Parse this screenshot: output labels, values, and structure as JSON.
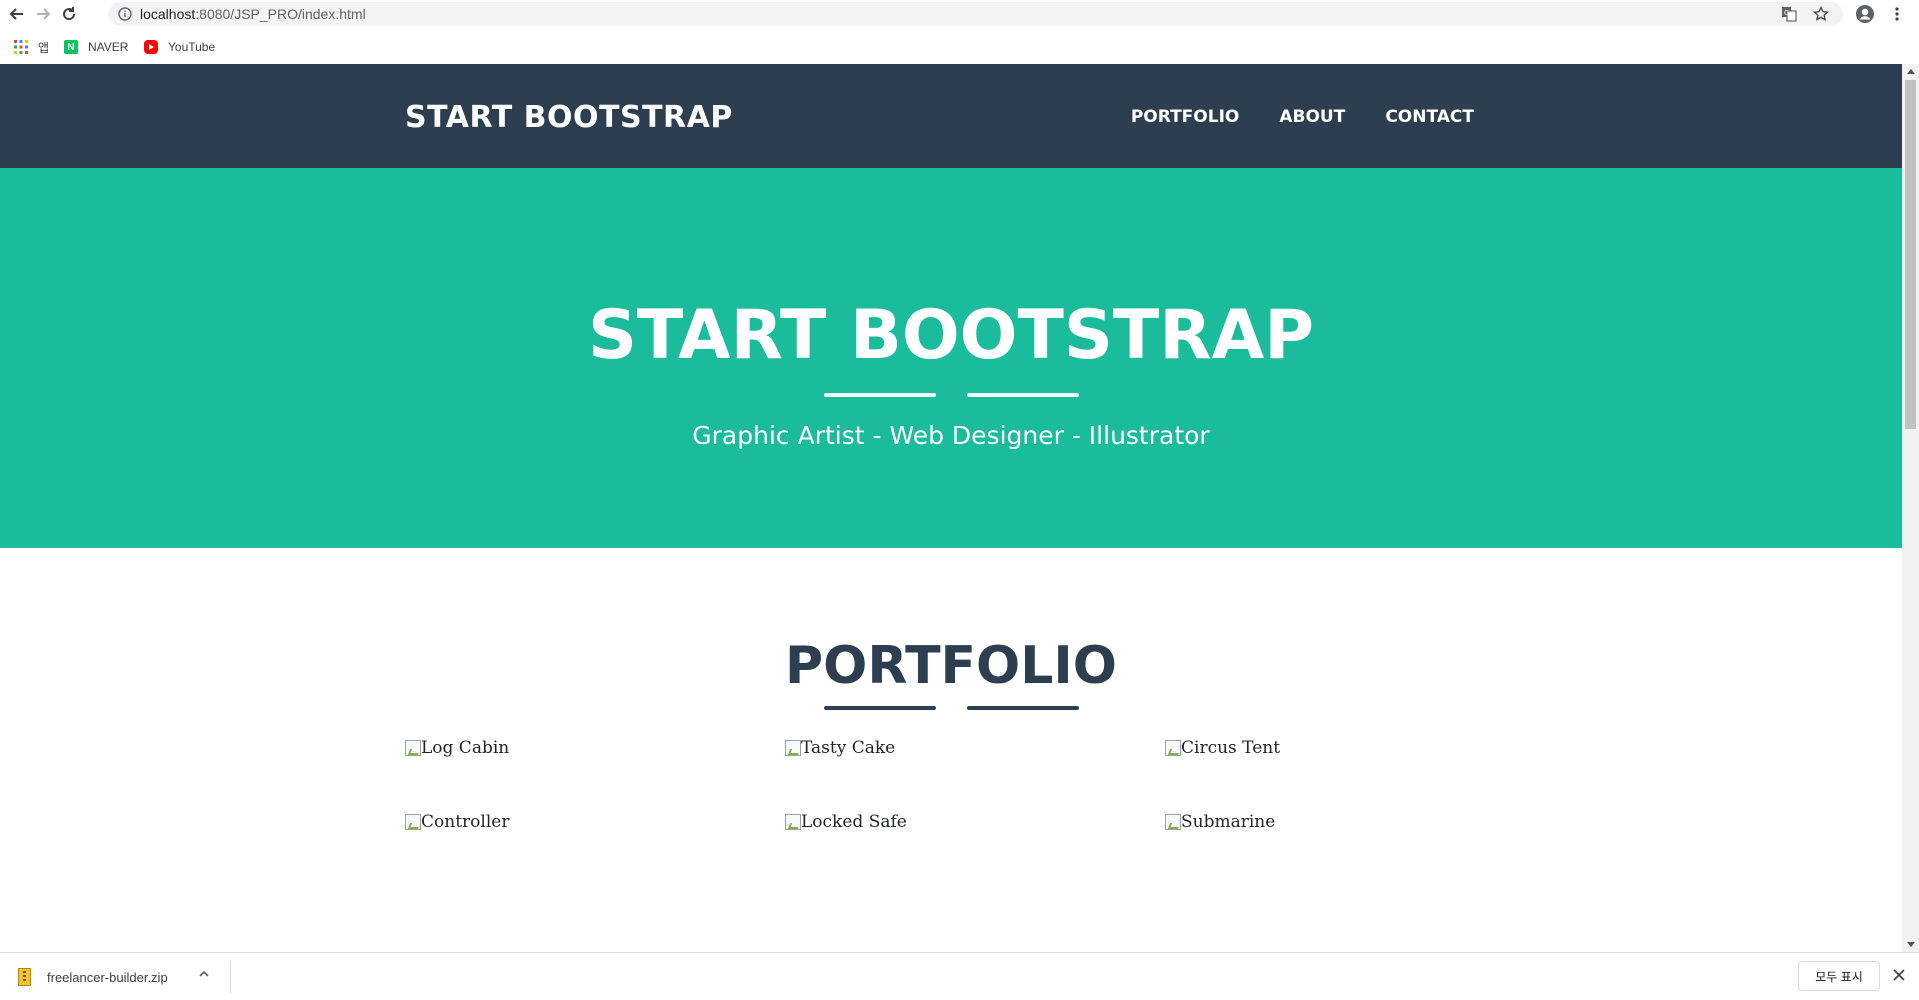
{
  "browser": {
    "url_host": "localhost",
    "url_path": ":8080/JSP_PRO/index.html",
    "bookmarks": [
      {
        "label": "앱",
        "icon": "apps-grid-icon"
      },
      {
        "label": "NAVER",
        "icon": "naver-icon"
      },
      {
        "label": "YouTube",
        "icon": "youtube-icon"
      }
    ]
  },
  "navbar": {
    "brand": "START BOOTSTRAP",
    "links": [
      "PORTFOLIO",
      "ABOUT",
      "CONTACT"
    ]
  },
  "masthead": {
    "title": "START BOOTSTRAP",
    "tagline": "Graphic Artist - Web Designer - Illustrator"
  },
  "portfolio": {
    "heading": "PORTFOLIO",
    "items": [
      "Log Cabin",
      "Tasty Cake",
      "Circus Tent",
      "Controller",
      "Locked Safe",
      "Submarine"
    ]
  },
  "downloads": {
    "filename": "freelancer-builder.zip",
    "show_all": "모두 표시"
  },
  "colors": {
    "navbar": "#2c3e50",
    "masthead": "#1abc9c",
    "heading": "#2c3e50"
  }
}
